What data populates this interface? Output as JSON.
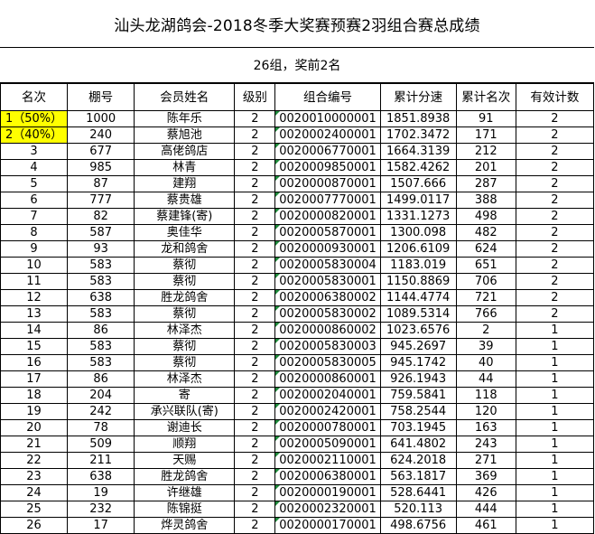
{
  "title": "汕头龙湖鸽会-2018冬季大奖赛预赛2羽组合赛总成绩",
  "subtitle": "26组，奖前2名",
  "headers": [
    "名次",
    "棚号",
    "会员姓名",
    "级别",
    "组合编号",
    "累计分速",
    "累计名次",
    "有效计数"
  ],
  "rows": [
    {
      "rank": "1（50%）",
      "shed": "1000",
      "name": "陈年乐",
      "level": "2",
      "code": "0020010000001",
      "speed": "1851.8938",
      "cum_rank": "91",
      "count": "2"
    },
    {
      "rank": "2（40%）",
      "shed": "240",
      "name": "蔡旭池",
      "level": "2",
      "code": "0020002400001",
      "speed": "1702.3472",
      "cum_rank": "171",
      "count": "2"
    },
    {
      "rank": "3",
      "shed": "677",
      "name": "高佬鸽店",
      "level": "2",
      "code": "0020006770001",
      "speed": "1664.3139",
      "cum_rank": "212",
      "count": "2"
    },
    {
      "rank": "4",
      "shed": "985",
      "name": "林青",
      "level": "2",
      "code": "0020009850001",
      "speed": "1582.4262",
      "cum_rank": "201",
      "count": "2"
    },
    {
      "rank": "5",
      "shed": "87",
      "name": "建翔",
      "level": "2",
      "code": "0020000870001",
      "speed": "1507.666",
      "cum_rank": "287",
      "count": "2"
    },
    {
      "rank": "6",
      "shed": "777",
      "name": "蔡贵雄",
      "level": "2",
      "code": "0020007770001",
      "speed": "1499.0117",
      "cum_rank": "388",
      "count": "2"
    },
    {
      "rank": "7",
      "shed": "82",
      "name": "蔡建锋(寄)",
      "level": "2",
      "code": "0020000820001",
      "speed": "1331.1273",
      "cum_rank": "498",
      "count": "2"
    },
    {
      "rank": "8",
      "shed": "587",
      "name": "奥佳华",
      "level": "2",
      "code": "0020005870001",
      "speed": "1300.098",
      "cum_rank": "482",
      "count": "2"
    },
    {
      "rank": "9",
      "shed": "93",
      "name": "龙和鸽舍",
      "level": "2",
      "code": "0020000930001",
      "speed": "1206.6109",
      "cum_rank": "624",
      "count": "2"
    },
    {
      "rank": "10",
      "shed": "583",
      "name": "蔡彻",
      "level": "2",
      "code": "0020005830004",
      "speed": "1183.019",
      "cum_rank": "651",
      "count": "2"
    },
    {
      "rank": "11",
      "shed": "583",
      "name": "蔡彻",
      "level": "2",
      "code": "0020005830001",
      "speed": "1150.8869",
      "cum_rank": "706",
      "count": "2"
    },
    {
      "rank": "12",
      "shed": "638",
      "name": "胜龙鸽舍",
      "level": "2",
      "code": "0020006380002",
      "speed": "1144.4774",
      "cum_rank": "721",
      "count": "2"
    },
    {
      "rank": "13",
      "shed": "583",
      "name": "蔡彻",
      "level": "2",
      "code": "0020005830002",
      "speed": "1089.5314",
      "cum_rank": "766",
      "count": "2"
    },
    {
      "rank": "14",
      "shed": "86",
      "name": "林泽杰",
      "level": "2",
      "code": "0020000860002",
      "speed": "1023.6576",
      "cum_rank": "2",
      "count": "1"
    },
    {
      "rank": "15",
      "shed": "583",
      "name": "蔡彻",
      "level": "2",
      "code": "0020005830003",
      "speed": "945.2697",
      "cum_rank": "39",
      "count": "1"
    },
    {
      "rank": "16",
      "shed": "583",
      "name": "蔡彻",
      "level": "2",
      "code": "0020005830005",
      "speed": "945.1742",
      "cum_rank": "40",
      "count": "1"
    },
    {
      "rank": "17",
      "shed": "86",
      "name": "林泽杰",
      "level": "2",
      "code": "0020000860001",
      "speed": "926.1943",
      "cum_rank": "44",
      "count": "1"
    },
    {
      "rank": "18",
      "shed": "204",
      "name": "寄",
      "level": "2",
      "code": "0020002040001",
      "speed": "759.5841",
      "cum_rank": "118",
      "count": "1"
    },
    {
      "rank": "19",
      "shed": "242",
      "name": "承兴联队(寄)",
      "level": "2",
      "code": "0020002420001",
      "speed": "758.2544",
      "cum_rank": "120",
      "count": "1"
    },
    {
      "rank": "20",
      "shed": "78",
      "name": "谢迪长",
      "level": "2",
      "code": "0020000780001",
      "speed": "703.1945",
      "cum_rank": "163",
      "count": "1"
    },
    {
      "rank": "21",
      "shed": "509",
      "name": "顺翔",
      "level": "2",
      "code": "0020005090001",
      "speed": "641.4802",
      "cum_rank": "243",
      "count": "1"
    },
    {
      "rank": "22",
      "shed": "211",
      "name": "天赐",
      "level": "2",
      "code": "0020002110001",
      "speed": "624.2018",
      "cum_rank": "271",
      "count": "1"
    },
    {
      "rank": "23",
      "shed": "638",
      "name": "胜龙鸽舍",
      "level": "2",
      "code": "0020006380001",
      "speed": "563.1817",
      "cum_rank": "369",
      "count": "1"
    },
    {
      "rank": "24",
      "shed": "19",
      "name": "许继雄",
      "level": "2",
      "code": "0020000190001",
      "speed": "528.6441",
      "cum_rank": "426",
      "count": "1"
    },
    {
      "rank": "25",
      "shed": "232",
      "name": "陈锦挺",
      "level": "2",
      "code": "0020002320001",
      "speed": "520.113",
      "cum_rank": "444",
      "count": "1"
    },
    {
      "rank": "26",
      "shed": "17",
      "name": "烨灵鸽舍",
      "level": "2",
      "code": "0020000170001",
      "speed": "498.6756",
      "cum_rank": "461",
      "count": "1"
    }
  ],
  "highlight_color": "#ffff00",
  "highlighted_rows": [
    0,
    1
  ]
}
